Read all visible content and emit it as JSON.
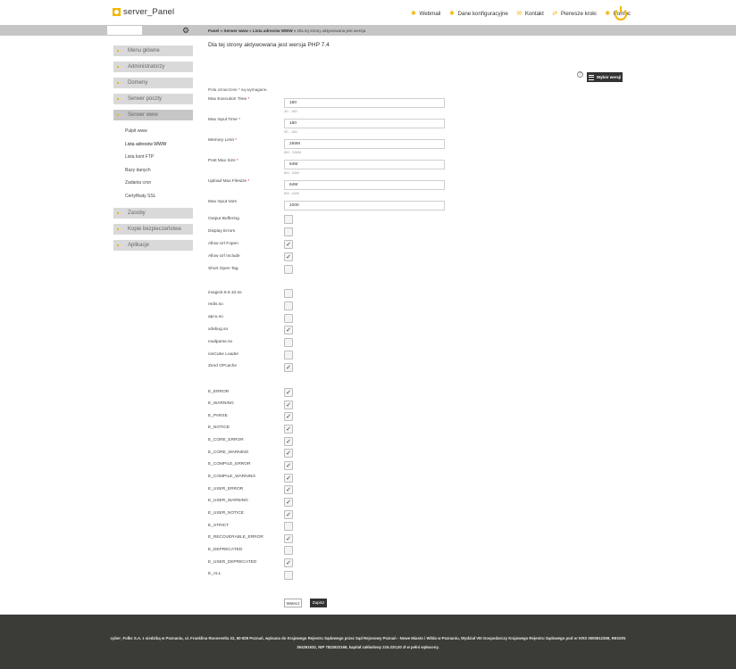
{
  "header": {
    "logo_text": "server_Panel",
    "nav": [
      {
        "label": "Webmail",
        "icon": "webmail-icon"
      },
      {
        "label": "Dane konfiguracyjne",
        "icon": "config-icon"
      },
      {
        "label": "Kontakt",
        "icon": "mail-icon"
      },
      {
        "label": "Pierwsze kroki",
        "icon": "steps-icon"
      },
      {
        "label": "Pomoc",
        "icon": "help-gear-icon"
      }
    ],
    "accent_color": "#f2b600"
  },
  "breadcrumb": {
    "part1": "Panel",
    "sep1": " » ",
    "part2": "Serwer www",
    "sep2": " » ",
    "part3": "Lista adresów WWW",
    "sep3": " » ",
    "current": "Dla tej strony aktywowana jest wersja"
  },
  "sidebar": {
    "items": [
      {
        "label": "Menu główne"
      },
      {
        "label": "Administratorzy"
      },
      {
        "label": "Domeny"
      },
      {
        "label": "Serwer poczty"
      },
      {
        "label": "Serwer www"
      }
    ],
    "sub_items": [
      {
        "label": "Pulpit www"
      },
      {
        "label": "Lista adresów WWW"
      },
      {
        "label": "Lista kont FTP"
      },
      {
        "label": "Bazy danych"
      },
      {
        "label": "Zadania cron"
      },
      {
        "label": "Certyfikaty SSL"
      }
    ],
    "items_after": [
      {
        "label": "Zasoby"
      },
      {
        "label": "Kopie bezpieczeństwa"
      },
      {
        "label": "Aplikacje"
      }
    ]
  },
  "main": {
    "title": "Dla tej strony aktywowana jest wersja PHP 7.4",
    "help_icon": "?",
    "version_button": "Wybór wersji",
    "required_note": "Pola oznaczone * są wymagane.",
    "fields": [
      {
        "label": "Max Execution Time",
        "required": "*",
        "value": "180",
        "hint": "30 - 180"
      },
      {
        "label": "Max Input Time",
        "required": "*",
        "value": "180",
        "hint": "30 - 180"
      },
      {
        "label": "Memory Limit",
        "required": "*",
        "value": "256M",
        "hint": "8M - 256M"
      },
      {
        "label": "Post Max Size",
        "required": "*",
        "value": "64M",
        "hint": "8M - 64M"
      },
      {
        "label": "Upload Max Filesize",
        "required": "*",
        "value": "64M",
        "hint": "8M - 64M"
      },
      {
        "label": "Max Input Vars",
        "required": "",
        "value": "1000",
        "hint": ""
      }
    ],
    "options": [
      {
        "label": "Output Buffering",
        "checked": false
      },
      {
        "label": "Display Errors",
        "checked": false
      },
      {
        "label": "Allow Url Fopen",
        "checked": true
      },
      {
        "label": "Allow Url Include",
        "checked": true
      },
      {
        "label": "Short Open Tag",
        "checked": false
      }
    ],
    "extensions": [
      {
        "label": "imagick-6.9.10.so",
        "checked": false
      },
      {
        "label": "redis.so",
        "checked": false
      },
      {
        "label": "apcu.so",
        "checked": false
      },
      {
        "label": "xdebug.so",
        "checked": true
      },
      {
        "label": "mailparse.so",
        "checked": false
      },
      {
        "label": "ionCube Loader",
        "checked": false
      },
      {
        "label": "Zend OPcache",
        "checked": true
      }
    ],
    "errors": [
      {
        "label": "E_ERROR",
        "checked": true
      },
      {
        "label": "E_WARNING",
        "checked": true
      },
      {
        "label": "E_PARSE",
        "checked": true
      },
      {
        "label": "E_NOTICE",
        "checked": true
      },
      {
        "label": "E_CORE_ERROR",
        "checked": true
      },
      {
        "label": "E_CORE_WARNING",
        "checked": true
      },
      {
        "label": "E_COMPILE_ERROR",
        "checked": true
      },
      {
        "label": "E_COMPILE_WARNING",
        "checked": true
      },
      {
        "label": "E_USER_ERROR",
        "checked": true
      },
      {
        "label": "E_USER_WARNING",
        "checked": true
      },
      {
        "label": "E_USER_NOTICE",
        "checked": true
      },
      {
        "label": "E_STRICT",
        "checked": false
      },
      {
        "label": "E_RECOVERABLE_ERROR",
        "checked": true
      },
      {
        "label": "E_DEPRECATED",
        "checked": false
      },
      {
        "label": "E_USER_DEPRECATED",
        "checked": true
      },
      {
        "label": "E_ALL",
        "checked": false
      }
    ],
    "back_label": "Wstecz",
    "save_label": "Zapisz"
  },
  "footer": {
    "line1": "cyber_Folks S.A. z siedzibą w Poznaniu, ul. Franklina Roosevelta 22, 60-829 Poznań, wpisana do Krajowego Rejestru Sądowego przez Sąd Rejonowy Poznań - Nowe Miasto i Wilda w Poznaniu, Wydział VIII Gospodarczy Krajowego Rejestru Sądowego pod nr KRS 0000612359, REGON",
    "line2": "364261632, NIP 7822622168, kapitał zakładowy 215.220,00 zł w pełni wpłacony."
  }
}
